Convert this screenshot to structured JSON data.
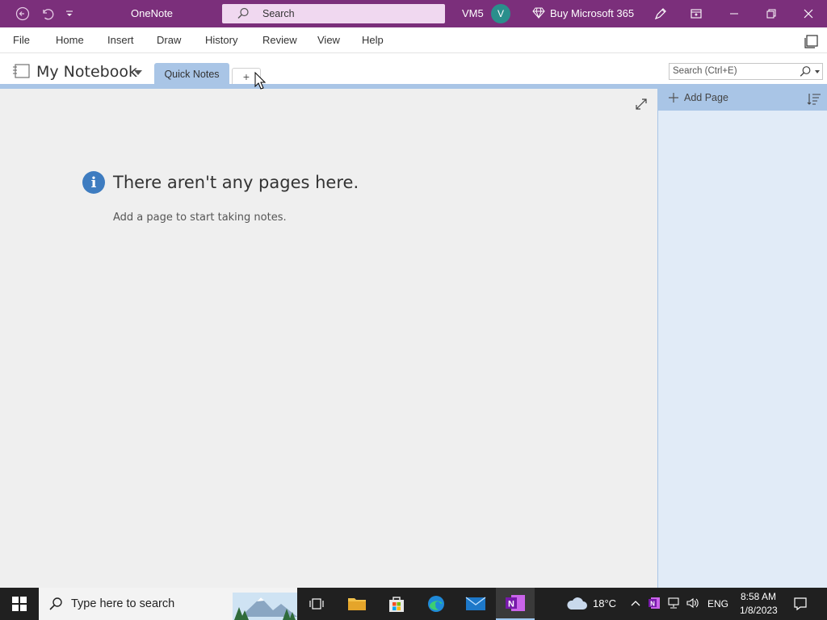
{
  "titlebar": {
    "app_title": "OneNote",
    "search_label": "Search",
    "user_name": "VM5",
    "avatar_initial": "V",
    "buy_label": "Buy Microsoft 365"
  },
  "menu": {
    "items": [
      "File",
      "Home",
      "Insert",
      "Draw",
      "History",
      "Review",
      "View",
      "Help"
    ]
  },
  "notebook": {
    "title": "My Notebook",
    "section_tab": "Quick Notes",
    "add_section_symbol": "+",
    "search_placeholder": "Search (Ctrl+E)"
  },
  "canvas": {
    "empty_title": "There aren't any pages here.",
    "empty_subtitle": "Add a page to start taking notes."
  },
  "pages_pane": {
    "add_page_label": "Add Page"
  },
  "taskbar": {
    "search_placeholder": "Type here to search",
    "temperature": "18°C",
    "language": "ENG",
    "time": "8:58 AM",
    "date": "1/8/2023"
  },
  "colors": {
    "titlebar": "#7b2f7b",
    "section_accent": "#a9c5e6",
    "pane_bg": "#e1ebf7",
    "info_icon": "#3e7cc0",
    "avatar": "#2a8f8c"
  }
}
